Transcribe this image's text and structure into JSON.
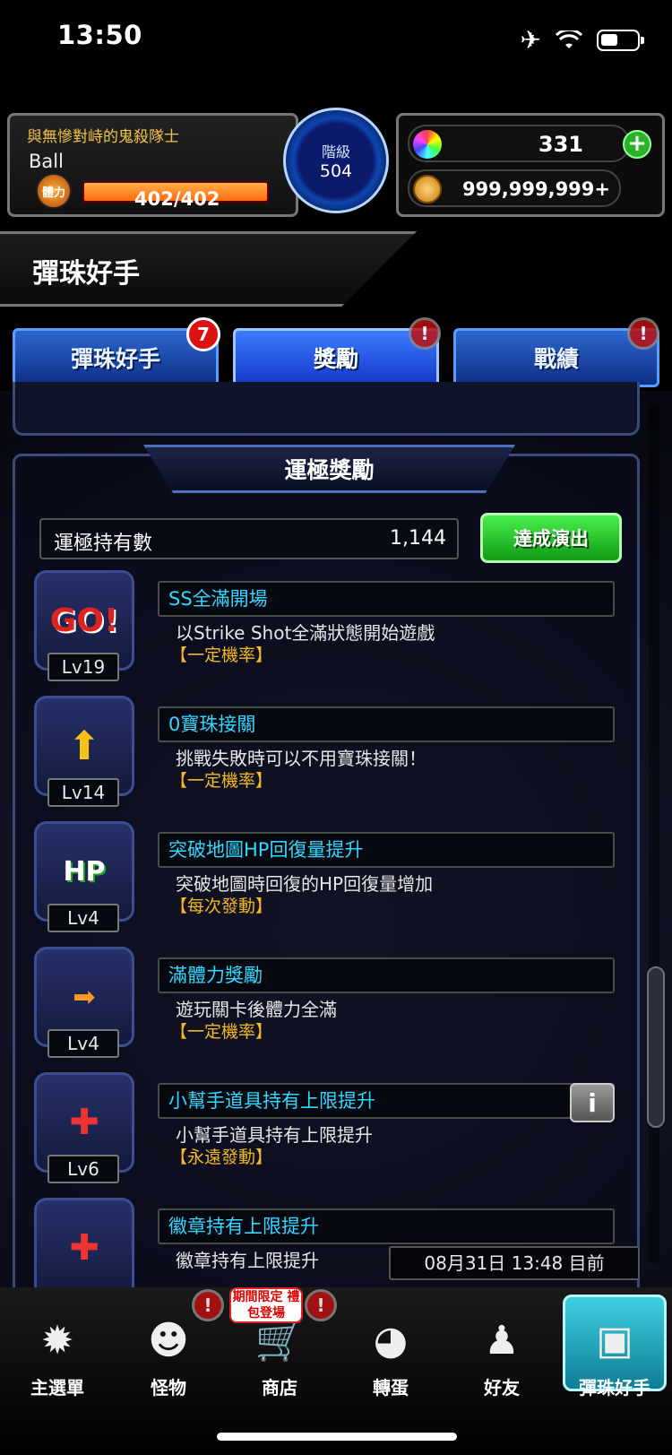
{
  "status": {
    "time": "13:50"
  },
  "player": {
    "title": "與無慘對峙的鬼殺隊士",
    "name": "Ball",
    "stamina_label": "體力",
    "stamina": "402/402",
    "rank_label": "階級",
    "rank": "504"
  },
  "currency": {
    "gems": "331",
    "gold": "999,999,999+"
  },
  "page": {
    "title": "彈珠好手"
  },
  "tabs": [
    {
      "label": "彈珠好手",
      "badge": "7"
    },
    {
      "label": "獎勵",
      "badge": "!"
    },
    {
      "label": "戰績",
      "badge": "!"
    }
  ],
  "panel": {
    "title": "運極獎勵",
    "luck_label": "運極持有數",
    "luck_value": "1,144",
    "button": "達成演出"
  },
  "items": [
    {
      "title": "SS全滿開場",
      "desc": "以Strike Shot全滿狀態開始遊戲",
      "tag": "【一定機率】",
      "level": "Lv19",
      "icon": "go-icon"
    },
    {
      "title": "0寶珠接關",
      "desc": "挑戰失敗時可以不用寶珠接關！",
      "tag": "【一定機率】",
      "level": "Lv14",
      "icon": "wings-arrow-icon"
    },
    {
      "title": "突破地圖HP回復量提升",
      "desc": "突破地圖時回復的HP回復量增加",
      "tag": "【每次發動】",
      "level": "Lv4",
      "icon": "hp-icon"
    },
    {
      "title": "滿體力獎勵",
      "desc": "遊玩關卡後體力全滿",
      "tag": "【一定機率】",
      "level": "Lv4",
      "icon": "stamina-icon"
    },
    {
      "title": "小幫手道具持有上限提升",
      "desc": "小幫手道具持有上限提升",
      "tag": "【永遠發動】",
      "level": "Lv6",
      "icon": "helper-item-icon"
    },
    {
      "title": "徽章持有上限提升",
      "desc": "徽章持有上限提升",
      "tag": "",
      "level": "",
      "icon": "badge-item-icon"
    }
  ],
  "timestamp": "08月31日 13:48 目前",
  "nav": [
    {
      "label": "主選單",
      "icon": "main-menu-icon"
    },
    {
      "label": "怪物",
      "icon": "monster-icon"
    },
    {
      "label": "商店",
      "icon": "shop-cart-icon"
    },
    {
      "label": "轉蛋",
      "icon": "gacha-egg-icon"
    },
    {
      "label": "好友",
      "icon": "friends-icon"
    },
    {
      "label": "彈珠好手",
      "icon": "marble-master-icon"
    }
  ],
  "promo": "期間限定 禮包登場"
}
